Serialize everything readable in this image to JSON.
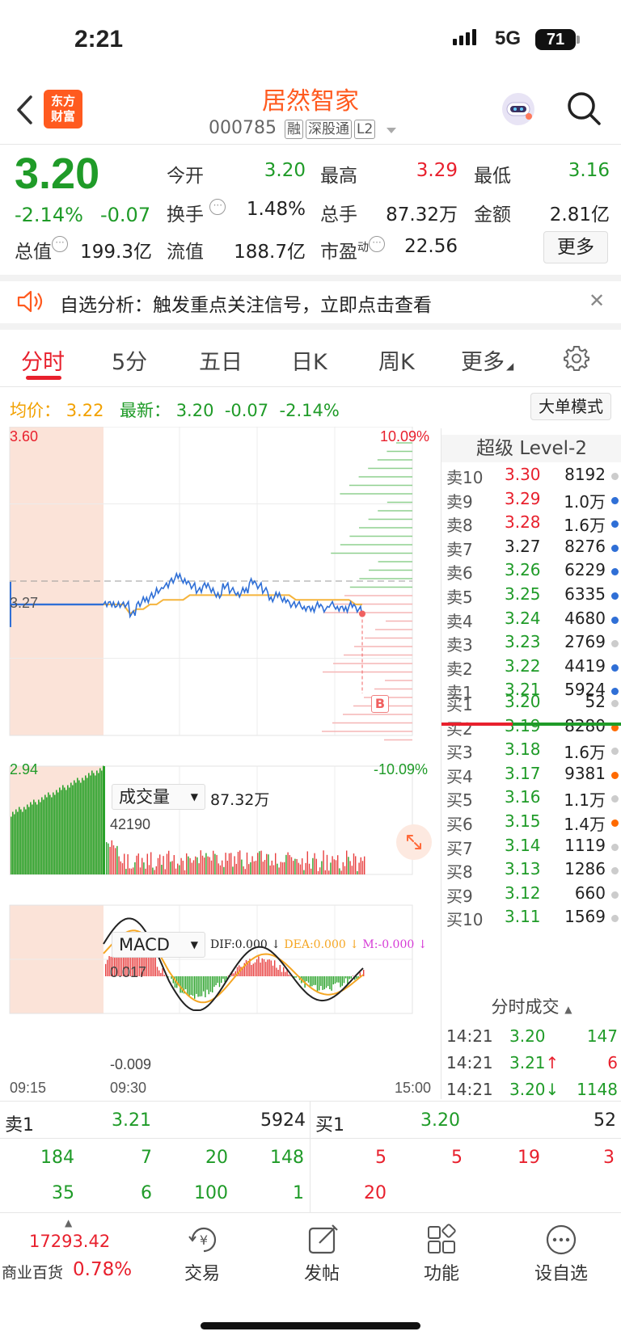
{
  "status_bar": {
    "time": "2:21",
    "network": "5G",
    "battery": "71"
  },
  "header": {
    "logo_line1": "东方",
    "logo_line2": "财富",
    "name": "居然智家",
    "code": "000785",
    "tags": [
      "融",
      "深股通",
      "L2"
    ]
  },
  "quote": {
    "price": "3.20",
    "change_pct": "-2.14%",
    "change": "-0.07",
    "fields": [
      {
        "label": "今开",
        "value": "3.20",
        "color": "green"
      },
      {
        "label": "最高",
        "value": "3.29",
        "color": "red"
      },
      {
        "label": "最低",
        "value": "3.16",
        "color": "green"
      },
      {
        "label": "换手",
        "value": "1.48%",
        "color": "black"
      },
      {
        "label": "总手",
        "value": "87.32万",
        "color": "black"
      },
      {
        "label": "金额",
        "value": "2.81亿",
        "color": "black"
      },
      {
        "label": "总值",
        "value": "199.3亿",
        "color": "black"
      },
      {
        "label": "流值",
        "value": "188.7亿",
        "color": "black"
      },
      {
        "label": "市盈",
        "sup": "动",
        "value": "22.56",
        "color": "black"
      }
    ],
    "more_label": "更多"
  },
  "alert": {
    "text": "自选分析：触发重点关注信号，立即点击查看"
  },
  "tabs": [
    {
      "label": "分时",
      "active": true
    },
    {
      "label": "5分"
    },
    {
      "label": "五日"
    },
    {
      "label": "日K"
    },
    {
      "label": "周K"
    },
    {
      "label": "更多"
    }
  ],
  "info_line": {
    "avg_label": "均价：",
    "avg_value": "3.22",
    "latest_label": "最新：",
    "latest_value": "3.20",
    "latest_change": "-0.07",
    "latest_pct": "-2.14%",
    "bigorder_label": "大单模式"
  },
  "chart_data": [
    {
      "type": "line",
      "title": "分时",
      "y_max_label": "3.60",
      "y_min_label": "2.94",
      "y_mid_label": "3.27",
      "pct_max_label": "10.09%",
      "pct_min_label": "-10.09%",
      "ylim": [
        2.94,
        3.6
      ],
      "x_labels": [
        "09:15",
        "09:30",
        "15:00"
      ],
      "series": [
        {
          "name": "price",
          "values": [
            3.22,
            3.22,
            3.22,
            3.22,
            3.2,
            3.22,
            3.23,
            3.24,
            3.25,
            3.26,
            3.27,
            3.28,
            3.27,
            3.26,
            3.25,
            3.26,
            3.25,
            3.24,
            3.26,
            3.25,
            3.24,
            3.25,
            3.27,
            3.26,
            3.25,
            3.23,
            3.24,
            3.23,
            3.22,
            3.22,
            3.21,
            3.21,
            3.22,
            3.21,
            3.22,
            3.21,
            3.21,
            3.22,
            3.21,
            3.2
          ]
        },
        {
          "name": "avg",
          "values": [
            3.22,
            3.22,
            3.22,
            3.22,
            3.2,
            3.21,
            3.21,
            3.22,
            3.22,
            3.23,
            3.23,
            3.23,
            3.23,
            3.24,
            3.24,
            3.24,
            3.24,
            3.24,
            3.24,
            3.24,
            3.24,
            3.24,
            3.24,
            3.24,
            3.24,
            3.24,
            3.24,
            3.24,
            3.24,
            3.23,
            3.23,
            3.23,
            3.23,
            3.23,
            3.23,
            3.23,
            3.23,
            3.23,
            3.22,
            3.22
          ]
        }
      ],
      "marker_label": "B"
    },
    {
      "type": "bar",
      "title": "成交量",
      "total_label": "87.32万",
      "max_label": "42190"
    },
    {
      "type": "bar",
      "title": "MACD",
      "dif_label": "DIF:0.000",
      "dea_label": "DEA:0.000",
      "m_label": "M:-0.000",
      "max_label": "0.017",
      "min_label": "-0.009"
    }
  ],
  "orderbook": {
    "title": "超级 Level-2",
    "asks": [
      {
        "label": "卖10",
        "price": "3.30",
        "vol": "8192",
        "pc": "red",
        "dot": "#ccc"
      },
      {
        "label": "卖9",
        "price": "3.29",
        "vol": "1.0万",
        "pc": "red",
        "dot": "#2f6fd6"
      },
      {
        "label": "卖8",
        "price": "3.28",
        "vol": "1.6万",
        "pc": "red",
        "dot": "#2f6fd6"
      },
      {
        "label": "卖7",
        "price": "3.27",
        "vol": "8276",
        "pc": "black",
        "dot": "#2f6fd6"
      },
      {
        "label": "卖6",
        "price": "3.26",
        "vol": "6229",
        "pc": "green",
        "dot": "#2f6fd6"
      },
      {
        "label": "卖5",
        "price": "3.25",
        "vol": "6335",
        "pc": "green",
        "dot": "#2f6fd6"
      },
      {
        "label": "卖4",
        "price": "3.24",
        "vol": "4680",
        "pc": "green",
        "dot": "#2f6fd6"
      },
      {
        "label": "卖3",
        "price": "3.23",
        "vol": "2769",
        "pc": "green",
        "dot": "#ccc"
      },
      {
        "label": "卖2",
        "price": "3.22",
        "vol": "4419",
        "pc": "green",
        "dot": "#2f6fd6"
      },
      {
        "label": "卖1",
        "price": "3.21",
        "vol": "5924",
        "pc": "green",
        "dot": "#2f6fd6"
      }
    ],
    "bids": [
      {
        "label": "买1",
        "price": "3.20",
        "vol": "52",
        "pc": "green",
        "dot": "#ccc"
      },
      {
        "label": "买2",
        "price": "3.19",
        "vol": "8280",
        "pc": "green",
        "dot": "#ff6a00"
      },
      {
        "label": "买3",
        "price": "3.18",
        "vol": "1.6万",
        "pc": "green",
        "dot": "#ccc"
      },
      {
        "label": "买4",
        "price": "3.17",
        "vol": "9381",
        "pc": "green",
        "dot": "#ff6a00"
      },
      {
        "label": "买5",
        "price": "3.16",
        "vol": "1.1万",
        "pc": "green",
        "dot": "#ccc"
      },
      {
        "label": "买6",
        "price": "3.15",
        "vol": "1.4万",
        "pc": "green",
        "dot": "#ff6a00"
      },
      {
        "label": "买7",
        "price": "3.14",
        "vol": "1119",
        "pc": "green",
        "dot": "#ccc"
      },
      {
        "label": "买8",
        "price": "3.13",
        "vol": "1286",
        "pc": "green",
        "dot": "#ccc"
      },
      {
        "label": "买9",
        "price": "3.12",
        "vol": "660",
        "pc": "green",
        "dot": "#ccc"
      },
      {
        "label": "买10",
        "price": "3.11",
        "vol": "1569",
        "pc": "green",
        "dot": "#ccc"
      }
    ],
    "ticks_title": "分时成交",
    "ticks": [
      {
        "time": "14:21",
        "price": "3.20",
        "arrow": "",
        "vol": "147",
        "pc": "green",
        "vc": "green"
      },
      {
        "time": "14:21",
        "price": "3.21",
        "arrow": "↑",
        "vol": "6",
        "pc": "green",
        "vc": "red"
      },
      {
        "time": "14:21",
        "price": "3.20",
        "arrow": "↓",
        "vol": "1148",
        "pc": "green",
        "vc": "green"
      }
    ]
  },
  "bottom_book": {
    "sell_label": "卖1",
    "sell_price": "3.21",
    "sell_vol": "5924",
    "buy_label": "买1",
    "buy_price": "3.20",
    "buy_vol": "52",
    "sell_row1": [
      "184",
      "7",
      "20",
      "148"
    ],
    "sell_row2": [
      "35",
      "6",
      "100",
      "1"
    ],
    "buy_row1": [
      "5",
      "5",
      "19",
      "3"
    ],
    "buy_row2": [
      "20"
    ]
  },
  "bottom_nav": {
    "index_value": "17293.42",
    "index_name": "商业百货",
    "index_pct": "0.78%",
    "items": [
      "交易",
      "发帖",
      "功能",
      "设自选"
    ]
  },
  "colors": {
    "red": "#e8202d",
    "green": "#1f9b28",
    "orange": "#ff6a00",
    "blue": "#2f6fd6",
    "avg": "#f5b43c"
  }
}
